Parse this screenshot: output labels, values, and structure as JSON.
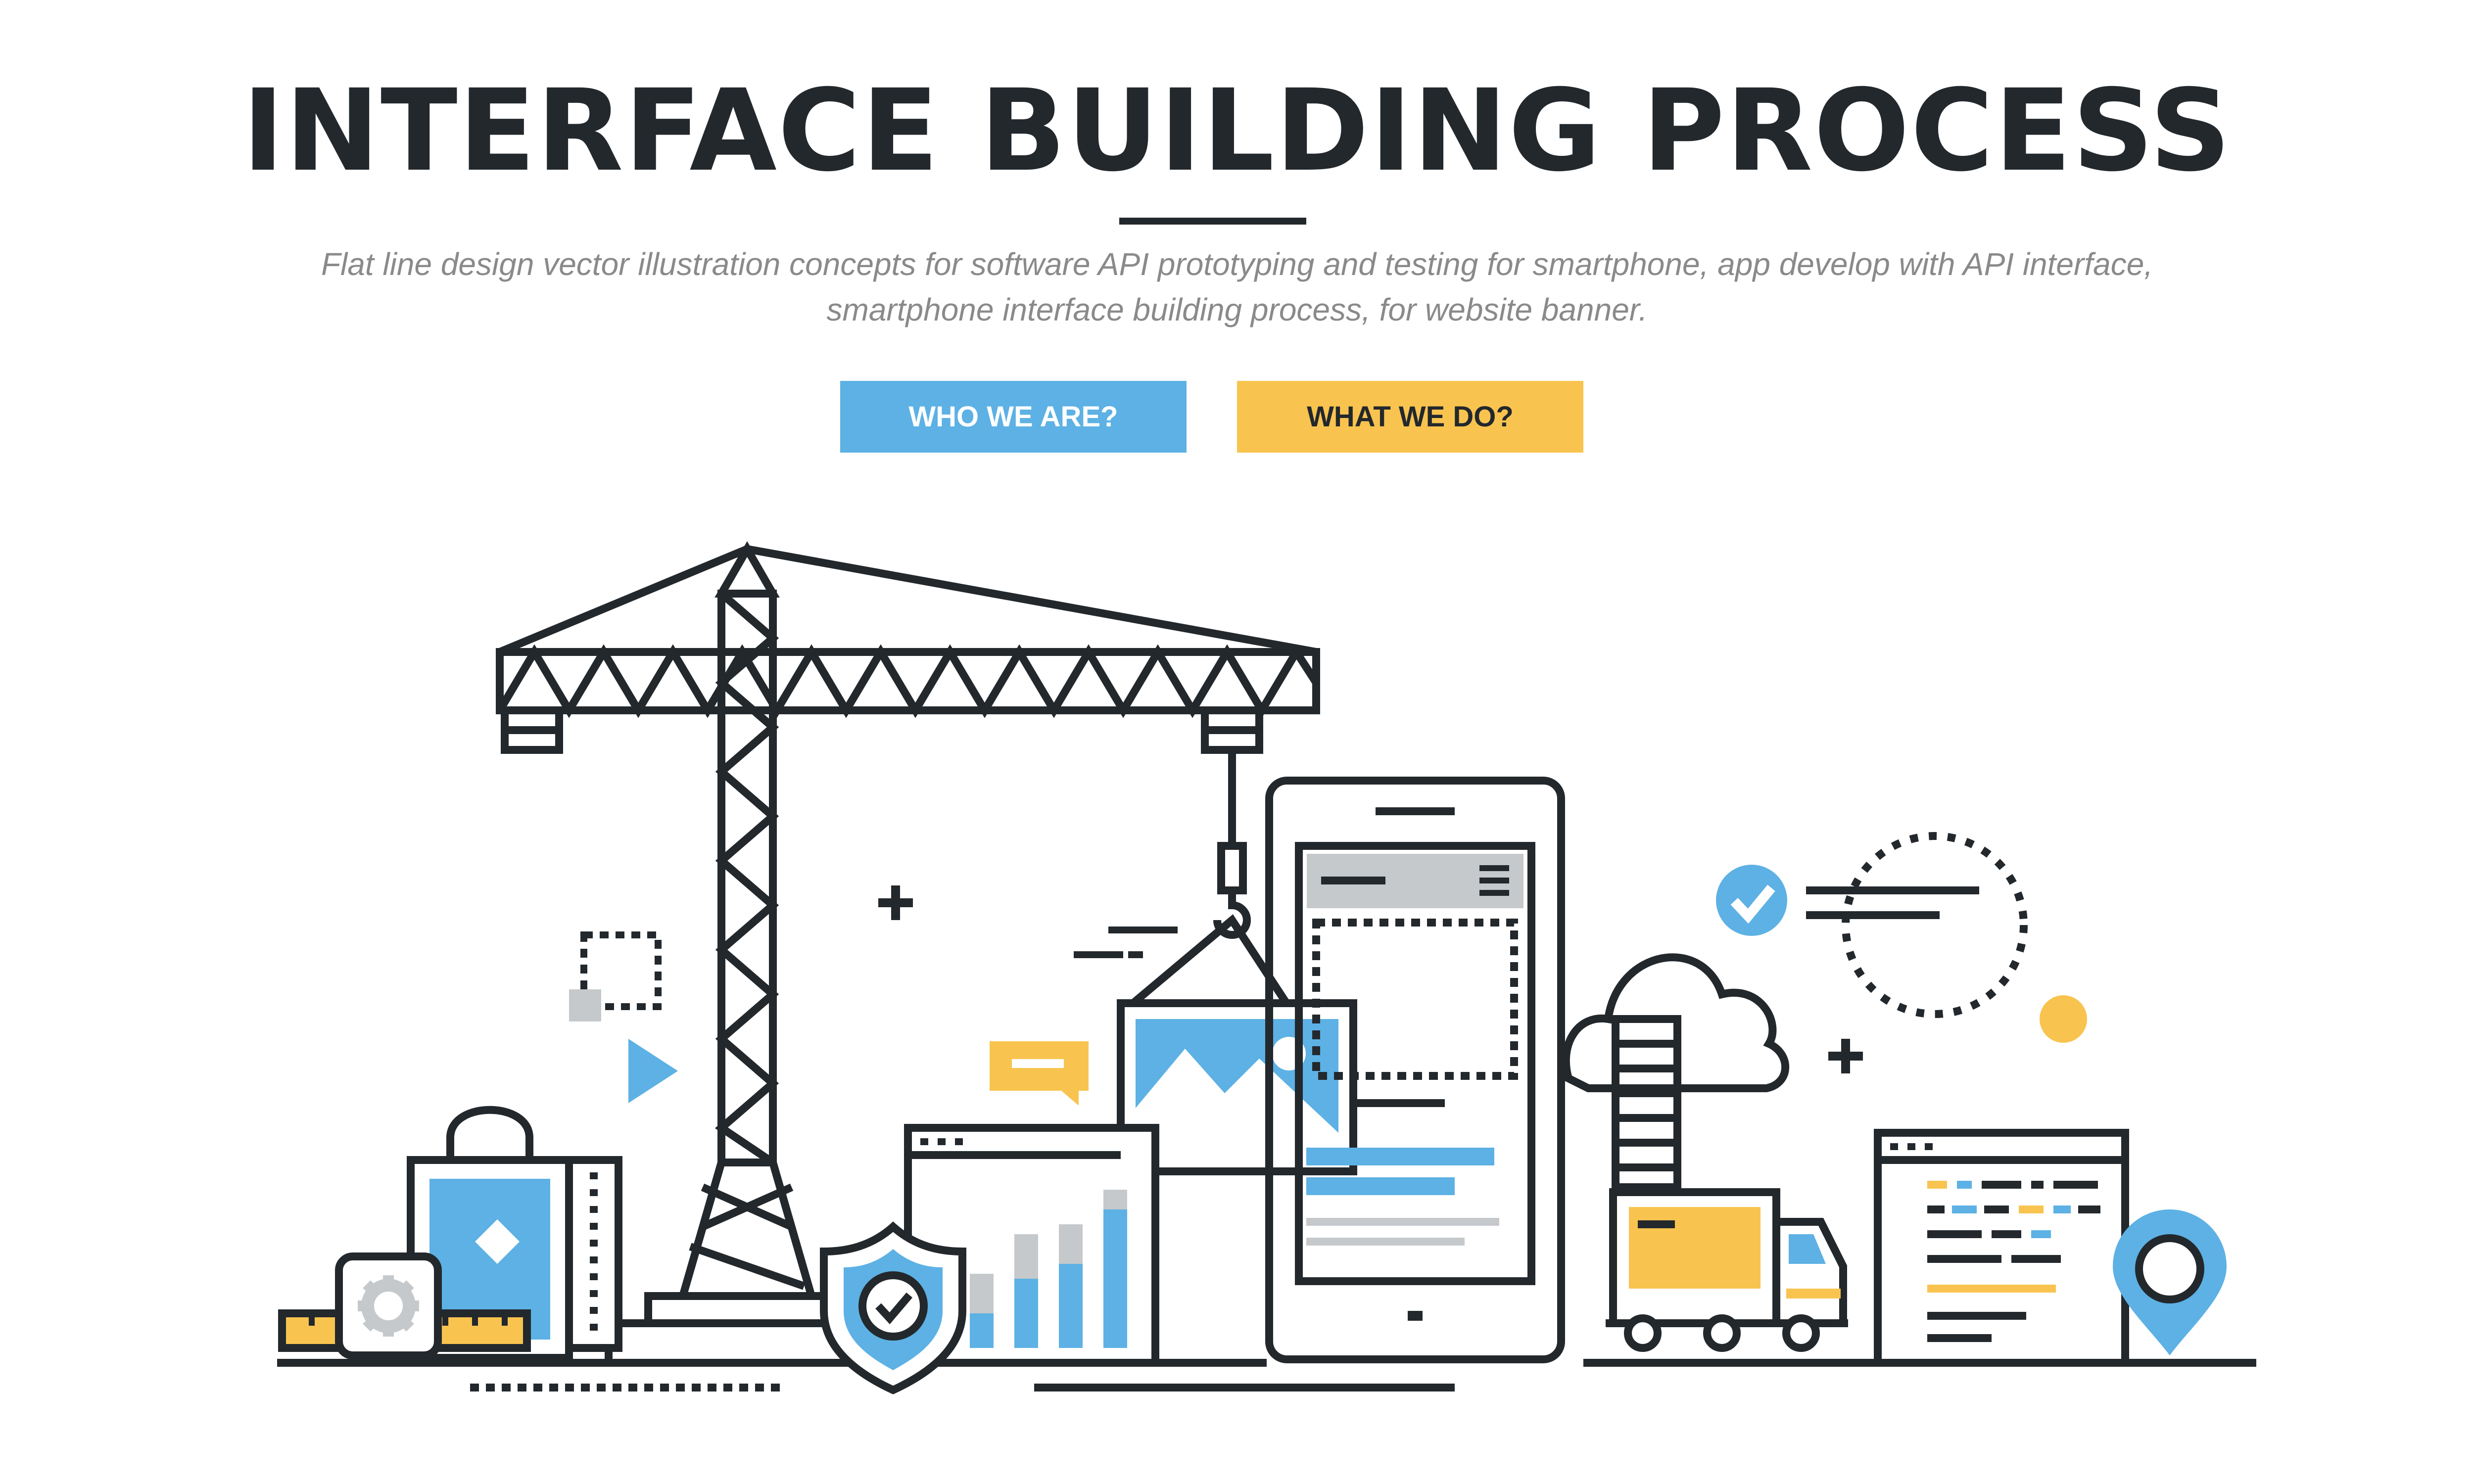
{
  "header": {
    "title": "INTERFACE BUILDING PROCESS",
    "subtitle": "Flat line design vector illustration concepts for software API prototyping and testing for smartphone, app develop with API interface, smartphone interface building process, for website banner."
  },
  "buttons": {
    "who_label": "WHO WE ARE?",
    "what_label": "WHAT WE DO?"
  },
  "illustration": {
    "items": [
      "tower-crane",
      "smartphone",
      "browser-window",
      "cloud",
      "delivery-truck",
      "code-window",
      "shopping-bag",
      "shield-check",
      "location-pin",
      "gear",
      "ruler",
      "bar-chart",
      "picture-frame",
      "chat-bubble",
      "check-badge",
      "dashed-circle"
    ]
  },
  "colors": {
    "ink": "#23282d",
    "blue": "#5db1e4",
    "yellow": "#f8c44f",
    "gray": "#c5c9cc",
    "subtitle": "#8a8a8a"
  }
}
